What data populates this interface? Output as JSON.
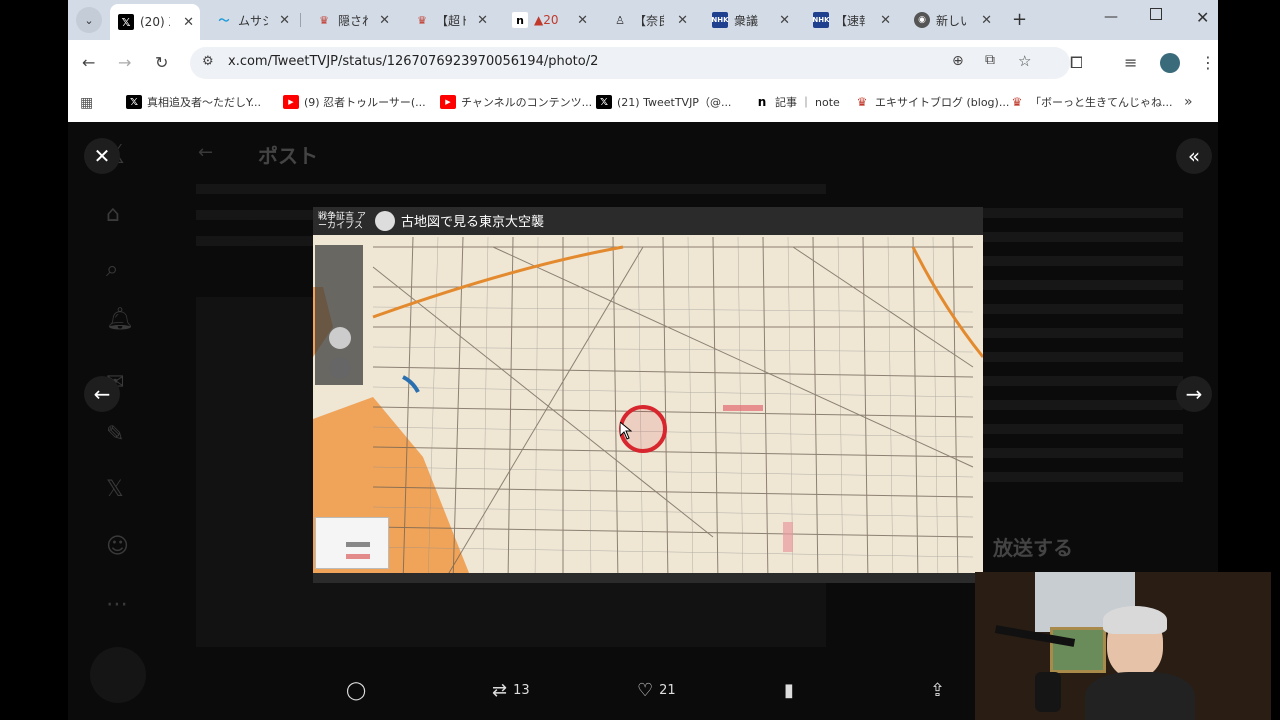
{
  "tabs": [
    {
      "label": "(20) X",
      "icon": "x-logo-icon",
      "active": true
    },
    {
      "label": "ムサシ",
      "icon": "swoosh-icon"
    },
    {
      "label": "隠され",
      "icon": "excite-icon"
    },
    {
      "label": "【超ド",
      "icon": "excite-icon"
    },
    {
      "label": "▲20",
      "icon": "note-icon"
    },
    {
      "label": "【奈良",
      "icon": "doc-icon"
    },
    {
      "label": "衆議",
      "icon": "nhk-icon"
    },
    {
      "label": "【速報",
      "icon": "nhk-icon"
    },
    {
      "label": "新しい",
      "icon": "chrome-icon"
    }
  ],
  "address": {
    "url": "x.com/TweetTVJP/status/1267076923970056194/photo/2"
  },
  "bookmarks": [
    {
      "label": "真相追及者〜ただしY...",
      "icon": "x-logo-icon"
    },
    {
      "label": "(9) 忍者トゥルーサー(...",
      "icon": "youtube-icon"
    },
    {
      "label": "チャンネルのコンテンツ...",
      "icon": "youtube-icon"
    },
    {
      "label": "(21) TweetTVJP（@...",
      "icon": "x-logo-icon"
    },
    {
      "label": "記事 ｜ note",
      "icon": "note-icon"
    },
    {
      "label": "エキサイトブログ (blog)...",
      "icon": "excite-icon"
    },
    {
      "label": "「ボーっと生きてんじゃね...",
      "icon": "excite-icon"
    }
  ],
  "background": {
    "header_title": "ポスト",
    "broadcast": "放送する"
  },
  "map": {
    "logo": "戦争証言 アーカイブス",
    "title": "古地図で見る東京大空襲"
  },
  "actions": {
    "retweets": "13",
    "likes": "21"
  },
  "colors": {
    "accent": "#1d9bf0",
    "map_orange": "#f0a45a",
    "map_red": "#d8262f"
  }
}
